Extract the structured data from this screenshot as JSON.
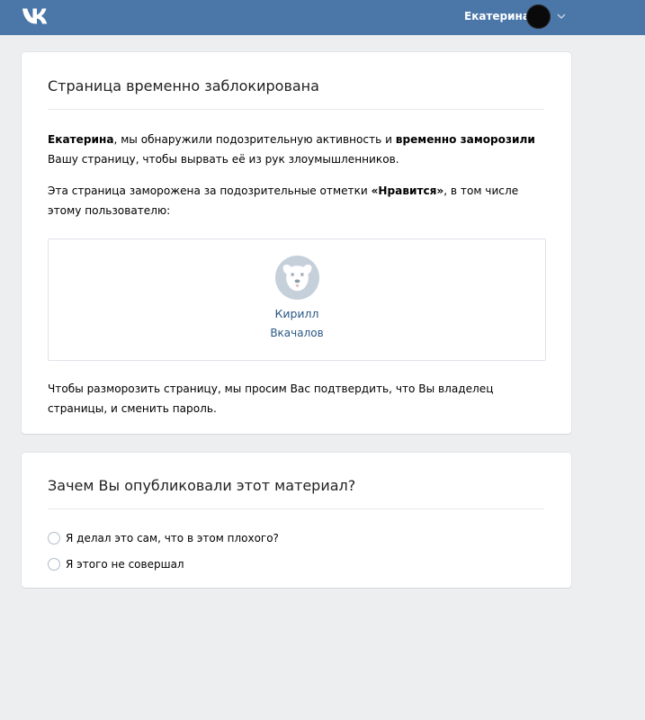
{
  "header": {
    "user_name": "Екатерина",
    "logo_icon": "vk-logo-icon",
    "menu_icon": "chevron-down-icon",
    "colors": {
      "bar": "#4a76a8"
    }
  },
  "blocked_card": {
    "title": "Страница временно заблокирована",
    "paragraph1": {
      "name": "Екатерина",
      "text_a": ", мы обнаружили подозрительную активность и ",
      "bold": "временно заморозили",
      "text_b": " Вашу страницу, чтобы вырвать её из рук злоумышленников."
    },
    "paragraph2": {
      "text_a": "Эта страница заморожена за подозрительные отметки ",
      "bold": "«Нравится»",
      "text_b": ", в том числе этому пользователю:"
    },
    "friend": {
      "first_name": "Кирилл",
      "last_name": "Вкачалов",
      "avatar_icon": "deactivated-dog-avatar-icon"
    },
    "paragraph3": "Чтобы разморозить страницу, мы просим Вас подтвердить, что Вы владелец страницы, и сменить пароль."
  },
  "question_card": {
    "title": "Зачем Вы опубликовали этот материал?",
    "options": [
      "Я делал это сам, что в этом плохого?",
      "Я этого не совершал"
    ]
  }
}
